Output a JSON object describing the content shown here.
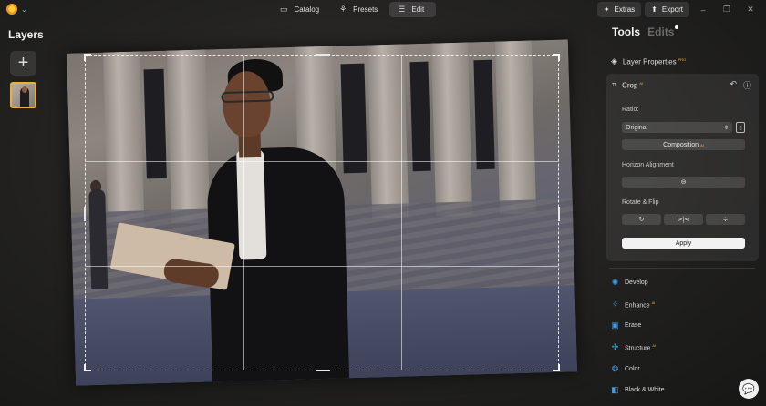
{
  "topbar": {
    "nav": [
      {
        "label": "Catalog",
        "icon": "folder-icon"
      },
      {
        "label": "Presets",
        "icon": "presets-icon"
      },
      {
        "label": "Edit",
        "icon": "sliders-icon",
        "active": true
      }
    ],
    "extras_label": "Extras",
    "export_label": "Export"
  },
  "layers": {
    "title": "Layers",
    "add_symbol": "+"
  },
  "right_panel": {
    "tab_tools": "Tools",
    "tab_edits": "Edits",
    "layer_properties": "Layer Properties",
    "layer_properties_badge": "PRO",
    "crop": {
      "title": "Crop",
      "badge": "AI",
      "ratio_label": "Ratio:",
      "ratio_value": "Original",
      "composition_label": "Composition",
      "composition_badge": "AI",
      "horizon_label": "Horizon Alignment",
      "rotate_flip_label": "Rotate & Flip",
      "apply_label": "Apply"
    },
    "tools": [
      {
        "label": "Develop",
        "icon": "develop-icon",
        "badge": ""
      },
      {
        "label": "Enhance",
        "icon": "enhance-icon",
        "badge": "AI"
      },
      {
        "label": "Erase",
        "icon": "erase-icon",
        "badge": ""
      },
      {
        "label": "Structure",
        "icon": "structure-icon",
        "badge": "AI"
      },
      {
        "label": "Color",
        "icon": "color-icon",
        "badge": ""
      },
      {
        "label": "Black & White",
        "icon": "black-white-icon",
        "badge": ""
      }
    ]
  },
  "colors": {
    "accent": "#e9b13a",
    "tool_icon": "#3aa0e8",
    "apply_bg": "#f2f2f2"
  }
}
